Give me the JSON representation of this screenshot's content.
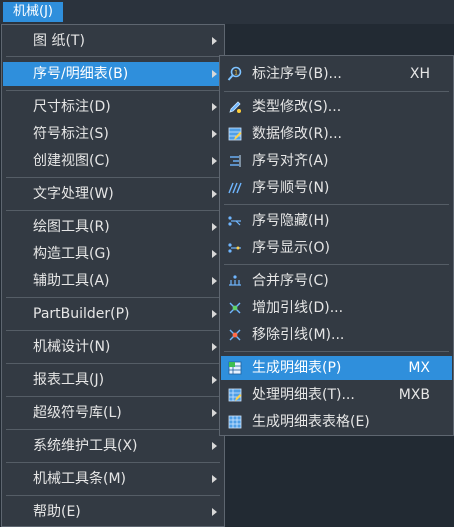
{
  "menubar": {
    "label": "机械(J)"
  },
  "main_menu": {
    "items": [
      {
        "label": "图    纸(T)"
      },
      {
        "label": "序号/明细表(B)"
      },
      {
        "label": "尺寸标注(D)"
      },
      {
        "label": "符号标注(S)"
      },
      {
        "label": "创建视图(C)"
      },
      {
        "label": "文字处理(W)"
      },
      {
        "label": "绘图工具(R)"
      },
      {
        "label": "构造工具(G)"
      },
      {
        "label": "辅助工具(A)"
      },
      {
        "label": "PartBuilder(P)"
      },
      {
        "label": "机械设计(N)"
      },
      {
        "label": "报表工具(J)"
      },
      {
        "label": "超级符号库(L)"
      },
      {
        "label": "系统维护工具(X)"
      },
      {
        "label": "机械工具条(M)"
      },
      {
        "label": "帮助(E)"
      }
    ]
  },
  "sub_menu": {
    "items": [
      {
        "label": "标注序号(B)...",
        "shortcut": "XH",
        "icon": "magnifier-number-icon"
      },
      {
        "label": "类型修改(S)...",
        "shortcut": "",
        "icon": "pencil-edit-icon"
      },
      {
        "label": "数据修改(R)...",
        "shortcut": "",
        "icon": "table-edit-icon"
      },
      {
        "label": "序号对齐(A)",
        "shortcut": "",
        "icon": "align-lines-icon"
      },
      {
        "label": "序号顺号(N)",
        "shortcut": "",
        "icon": "sequence-lines-icon"
      },
      {
        "label": "序号隐藏(H)",
        "shortcut": "",
        "icon": "hide-leader-icon"
      },
      {
        "label": "序号显示(O)",
        "shortcut": "",
        "icon": "show-leader-icon"
      },
      {
        "label": "合并序号(C)",
        "shortcut": "",
        "icon": "merge-numbers-icon"
      },
      {
        "label": "增加引线(D)...",
        "shortcut": "",
        "icon": "add-leader-icon"
      },
      {
        "label": "移除引线(M)...",
        "shortcut": "",
        "icon": "remove-leader-icon"
      },
      {
        "label": "生成明细表(P)",
        "shortcut": "MX",
        "icon": "generate-bom-icon"
      },
      {
        "label": "处理明细表(T)...",
        "shortcut": "MXB",
        "icon": "process-bom-icon"
      },
      {
        "label": "生成明细表表格(E)",
        "shortcut": "",
        "icon": "bom-table-icon"
      }
    ]
  },
  "colors": {
    "highlight": "#2f8fdc",
    "menu_bg": "#333a43",
    "background": "#222a33"
  }
}
